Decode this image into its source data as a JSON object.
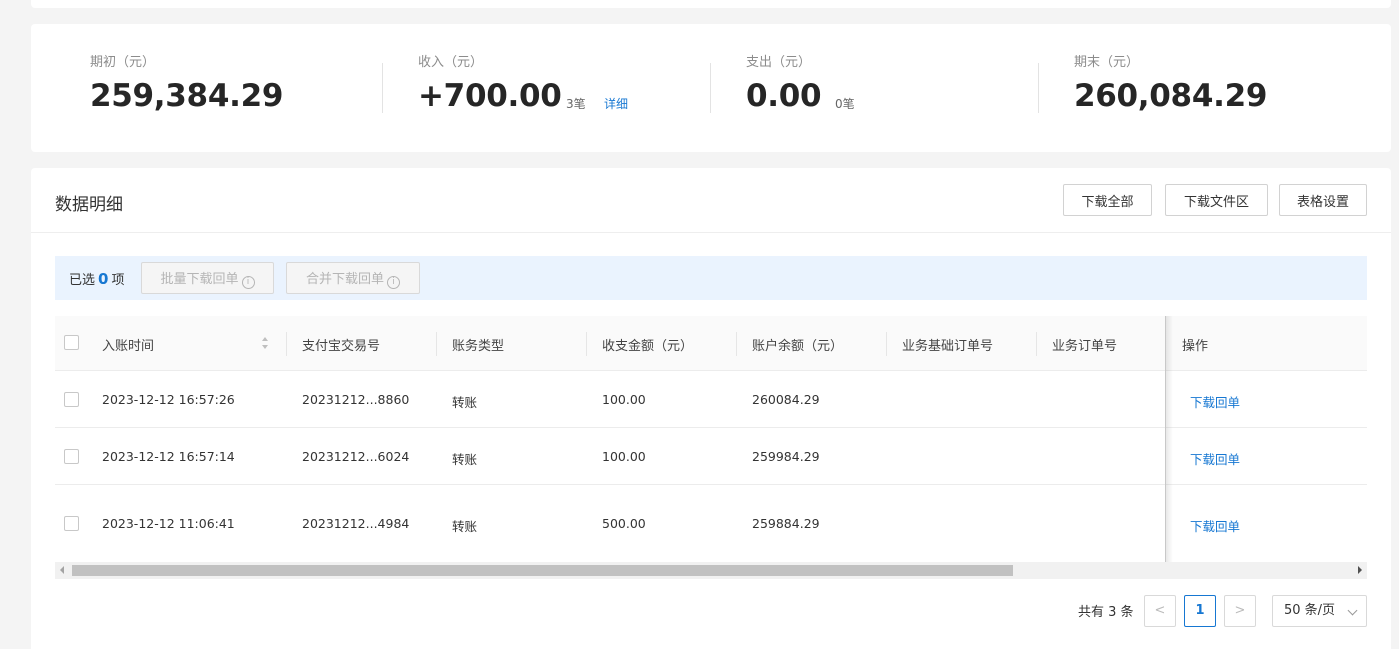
{
  "summary": {
    "opening": {
      "label": "期初（元）",
      "value": "259,384.29"
    },
    "income": {
      "label": "收入（元）",
      "value": "+700.00",
      "count": "3笔",
      "detail": "详细"
    },
    "expense": {
      "label": "支出（元）",
      "value": "0.00",
      "count": "0笔"
    },
    "closing": {
      "label": "期末（元）",
      "value": "260,084.29"
    }
  },
  "panel": {
    "title": "数据明细",
    "buttons": {
      "download_all": "下载全部",
      "download_files": "下载文件区",
      "table_settings": "表格设置"
    }
  },
  "selection": {
    "prefix": "已选",
    "count": "0",
    "suffix": "项",
    "batch_download": "批量下载回单",
    "merge_download": "合并下载回单"
  },
  "table": {
    "columns": [
      "入账时间",
      "支付宝交易号",
      "账务类型",
      "收支金额（元）",
      "账户余额（元）",
      "业务基础订单号",
      "业务订单号",
      "操作"
    ],
    "rows": [
      {
        "time": "2023-12-12 16:57:26",
        "trade_no": "20231212...8860",
        "type": "转账",
        "amount": "100.00",
        "balance": "260084.29",
        "action": "下载回单"
      },
      {
        "time": "2023-12-12 16:57:14",
        "trade_no": "20231212...6024",
        "type": "转账",
        "amount": "100.00",
        "balance": "259984.29",
        "action": "下载回单"
      },
      {
        "time": "2023-12-12 11:06:41",
        "trade_no": "20231212...4984",
        "type": "转账",
        "amount": "500.00",
        "balance": "259884.29",
        "action": "下载回单"
      }
    ]
  },
  "pagination": {
    "total": "共有 3 条",
    "current_page": "1",
    "prev": "<",
    "next": ">",
    "page_size": "50 条/页"
  },
  "colors": {
    "accent": "#1677d2",
    "selection_bg": "#eaf3fe"
  }
}
